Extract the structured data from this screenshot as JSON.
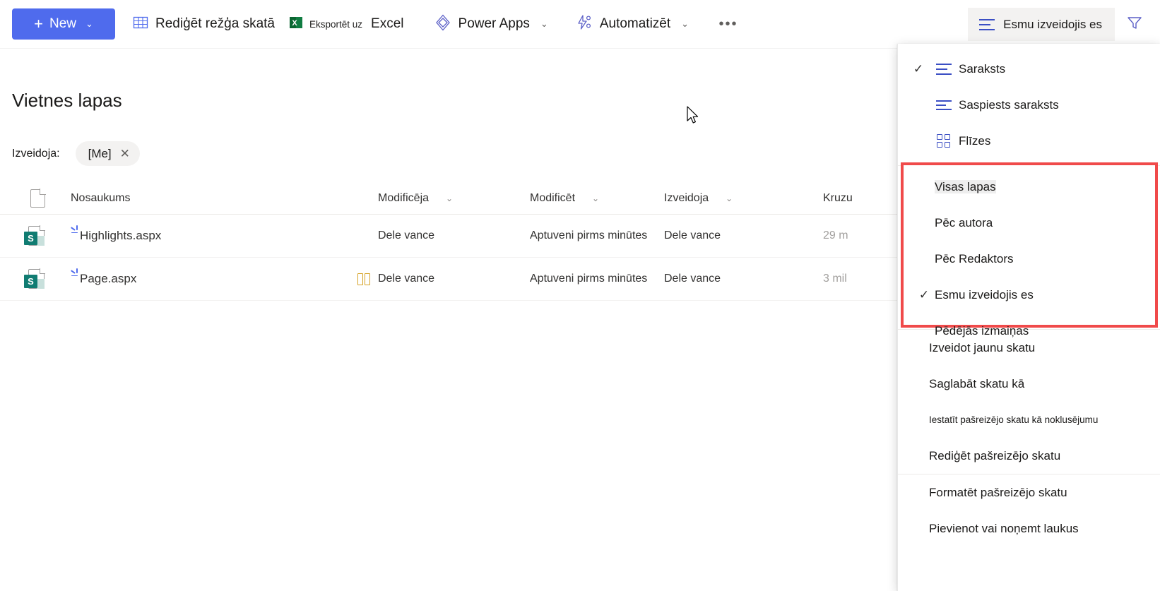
{
  "commandbar": {
    "new_button": {
      "label": "New",
      "plus": "+",
      "chevron": "⌄"
    },
    "items": [
      {
        "name": "edit-grid-view",
        "label": "Rediģēt režģa skatā",
        "icon": "grid-icon"
      },
      {
        "name": "export-to-excel",
        "label_small": "Eksportēt uz",
        "label_big": "Excel",
        "icon": "excel-icon"
      },
      {
        "name": "power-apps",
        "label": "Power Apps",
        "icon": "power-apps-icon",
        "chevron": "⌄"
      },
      {
        "name": "automate",
        "label": "Automatizēt",
        "icon": "automate-icon",
        "chevron": "⌄"
      }
    ],
    "overflow": "•••",
    "view_selector": {
      "label": "Esmu izveidojis es",
      "icon": "list-icon"
    },
    "filter_button": {
      "icon": "filter-icon"
    }
  },
  "page": {
    "title": "Vietnes lapas",
    "filter": {
      "label": "Izveidoja:",
      "pill_value": "[Me]",
      "pill_close": "✕"
    }
  },
  "table": {
    "columns": [
      {
        "key": "icon",
        "label": "",
        "icon": "document-icon"
      },
      {
        "key": "name",
        "label": "Nosaukums",
        "chevron": "⌄"
      },
      {
        "key": "mby",
        "label": "Modificēja",
        "chevron": "⌄"
      },
      {
        "key": "mod",
        "label": "Modificēt",
        "chevron": "⌄"
      },
      {
        "key": "cby",
        "label": "Izveidoja",
        "chevron": "⌄"
      },
      {
        "key": "size",
        "label": "Kruzu",
        "chevron": "⌄"
      }
    ],
    "rows": [
      {
        "name": "Highlights.aspx",
        "modified_by": "Dele vance",
        "modified": "Aptuveni pirms minūtes",
        "created_by": "Dele vance",
        "size": "29 m",
        "badge": ""
      },
      {
        "name": "Page.aspx",
        "modified_by": "Dele vance",
        "modified": "Aptuveni pirms minūtes",
        "created_by": "Dele vance",
        "size": "3 mil",
        "badge": "book-icon"
      }
    ]
  },
  "menu": {
    "view_types": [
      {
        "label": "Saraksts",
        "icon": "list-icon",
        "checked": true,
        "check": "✓"
      },
      {
        "label": "Saspiests saraksts",
        "icon": "compact-list-icon",
        "checked": false,
        "check": ""
      },
      {
        "label": "Flīzes",
        "icon": "tiles-icon",
        "checked": false,
        "check": ""
      }
    ],
    "saved_views": [
      {
        "label": "Visas lapas",
        "checked": false,
        "check": "",
        "highlighted": true
      },
      {
        "label": "Pēc autora",
        "checked": false,
        "check": ""
      },
      {
        "label": "Pēc Redaktors",
        "checked": false,
        "check": ""
      },
      {
        "label": "Esmu izveidojis es",
        "checked": true,
        "check": "✓"
      },
      {
        "label": "Pēdējās izmaiņas",
        "checked": false,
        "check": ""
      }
    ],
    "actions": [
      {
        "label": "Izveidot jaunu skatu",
        "small": false
      },
      {
        "label": "Saglabāt skatu kā",
        "small": false
      },
      {
        "label": "Iestatīt pašreizējo skatu kā noklusējumu",
        "small": true
      },
      {
        "label": "Rediģēt pašreizējo skatu",
        "small": false
      },
      {
        "label": "Formatēt pašreizējo skatu",
        "small": false,
        "divider_before": true
      },
      {
        "label": "Pievienot vai noņemt laukus",
        "small": false
      }
    ]
  },
  "colors": {
    "accent_blue": "#4f6bed",
    "icon_blue": "#3b4fc4",
    "excel_green": "#107c41",
    "sharepoint_teal": "#107c72",
    "highlight_red": "#f04a4a",
    "book_yellow": "#d6a225"
  }
}
